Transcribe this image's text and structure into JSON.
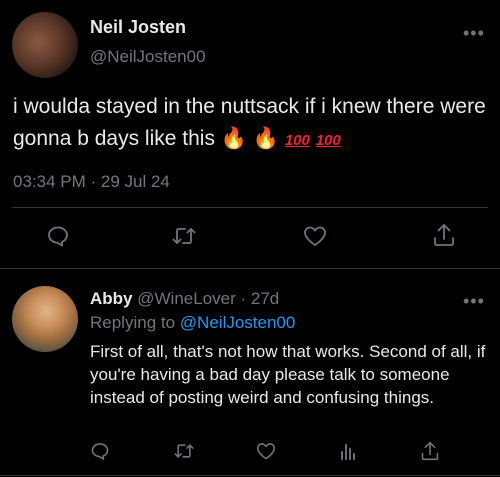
{
  "main_tweet": {
    "author_name": "Neil Josten",
    "author_handle": "@NeilJosten00",
    "text": "i woulda stayed in the nuttsack if i knew there were gonna b days like this",
    "emoji": [
      "🔥",
      "🔥",
      "100",
      "100"
    ],
    "timestamp": "03:34 PM · 29 Jul 24",
    "actions": [
      "reply-icon",
      "retweet-icon",
      "like-icon",
      "share-icon"
    ]
  },
  "reply": {
    "author_name": "Abby",
    "author_handle": "@WineLover",
    "age": "· 27d",
    "replying_label": "Replying to",
    "replying_handle": "@NeilJosten00",
    "text": "First of all, that's not how that works. Second of all, if you're having a bad day please talk to someone instead of posting weird and confusing things.",
    "actions": [
      "reply-icon",
      "retweet-icon",
      "like-icon",
      "views-icon",
      "share-icon"
    ]
  },
  "more_glyph": "•••",
  "colors": {
    "background": "#000000",
    "text": "#e7e9ea",
    "muted": "#71767b",
    "link": "#1d9bf0",
    "divider": "#2f3336"
  }
}
